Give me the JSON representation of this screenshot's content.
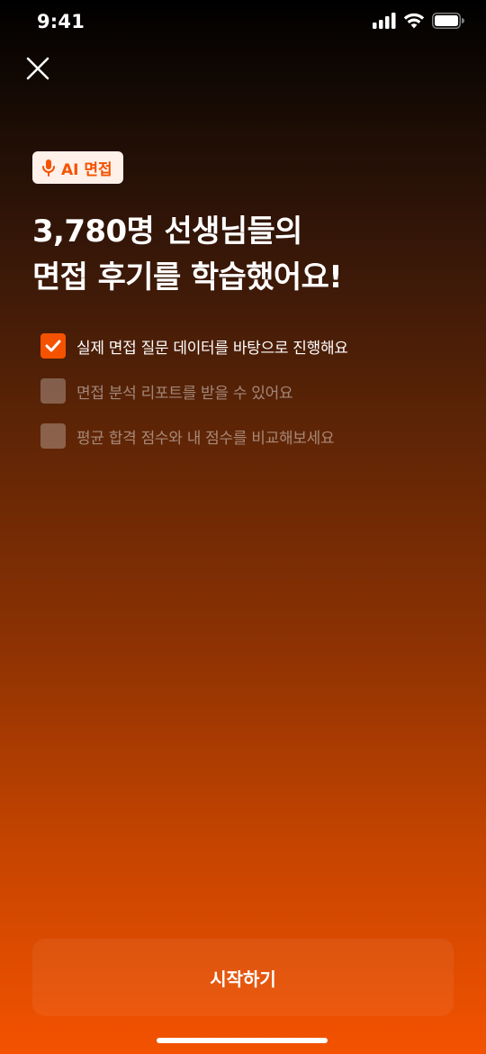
{
  "status_bar": {
    "time": "9:41"
  },
  "icons": {
    "close": "close-icon",
    "mic": "microphone-icon",
    "check": "checkmark-icon",
    "signal": "cellular-signal-icon",
    "wifi": "wifi-icon",
    "battery": "battery-icon"
  },
  "badge": {
    "label": "AI 면접"
  },
  "headline": {
    "line1": "3,780명 선생님들의",
    "line2": "면접 후기를 학습했어요!"
  },
  "checklist": [
    {
      "label": "실제 면접 질문 데이터를 바탕으로 진행해요",
      "checked": true
    },
    {
      "label": "면접 분석 리포트를 받을 수 있어요",
      "checked": false
    },
    {
      "label": "평균 합격 점수와 내 점수를 비교해보세요",
      "checked": false
    }
  ],
  "start_button": {
    "label": "시작하기"
  },
  "colors": {
    "accent": "#f45200",
    "badge_bg": "#fff1ea"
  }
}
